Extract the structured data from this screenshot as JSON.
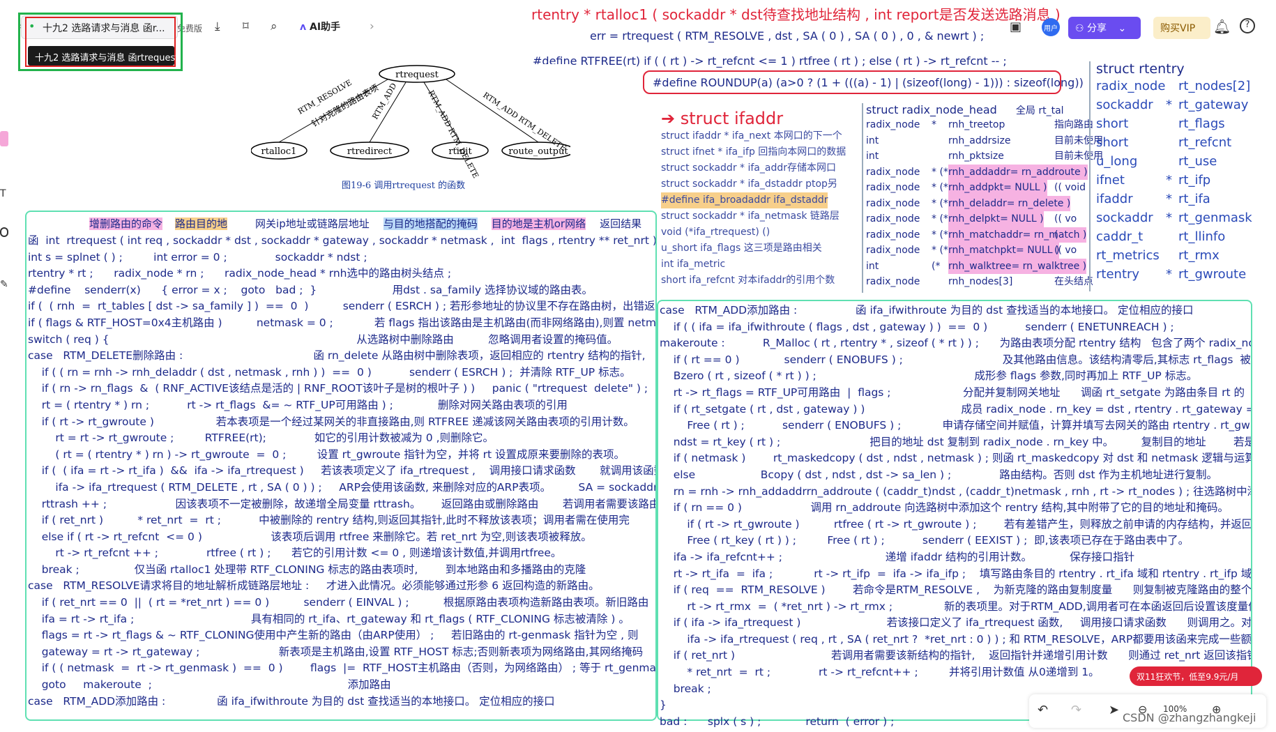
{
  "tab": {
    "title": "十九2 选路请求与消息 函r...",
    "free_label": "免费版",
    "tooltip": "十九2 选路请求与消息 函rtrequest"
  },
  "toolbar": {
    "ai_label": "AI助手",
    "share_label": "分享",
    "vip_label": "购买VIP",
    "user_label": "用户"
  },
  "header_code": {
    "line1": "rtentry * rtalloc1 ( sockaddr * dst待查找地址结构 ,  int  report是否发送选路消息 )",
    "line2": "err = rtrequest ( RTM_RESOLVE , dst , SA ( 0 ) , SA ( 0 ) , 0 , & newrt ) ;",
    "line3": "#define   RTFREE(rt)      if ( ( rt ) -> rt_refcnt <= 1 )    rtfree ( rt ) ;      else     ( rt ) -> rt_refcnt -- ;",
    "line4": "#define   ROUNDUP(a)      (a>0 ? (1 + (((a) - 1) | (sizeof(long) - 1))) : sizeof(long))"
  },
  "figure": {
    "root": "rtrequest",
    "leaves": [
      "rtalloc1",
      "rtredirect",
      "rtinit",
      "route_output"
    ],
    "edges": [
      "RTM_RESOLVE",
      "RTM_ADD",
      "RTM_ADD RTM_DELETE",
      "RTM_ADD RTM_DELETE"
    ],
    "edge_note": "针对克隆的路由表项",
    "caption": "图19-6   调用rtrequest   的函数"
  },
  "ifaddr": {
    "title": "struct ifaddr",
    "fields": [
      "struct ifaddr * ifa_next 本网口的下一个",
      "struct ifnet * ifa_ifp 回指向本网口的数据",
      "struct sockaddr * ifa_addr存储本网口",
      "struct sockaddr * ifa_dstaddr ptop另",
      "#define ifa_broadaddr ifa_dstaddr",
      "struct sockaddr * ifa_netmask 链路层",
      "void (*ifa_rtrequest) ()",
      "u_short ifa_flags      这三项是路由相关",
      "int ifa_metric",
      "short ifa_refcnt 对本ifaddr的引用个数"
    ]
  },
  "radix_head": {
    "title": "struct   radix_node_head",
    "rows": [
      [
        "radix_node",
        "*",
        "rnh_treetop",
        "指向路由"
      ],
      [
        "int",
        "",
        "rnh_addrsize",
        "目前未使用"
      ],
      [
        "int",
        "",
        "rnh_pktsize",
        "目前未使用"
      ],
      [
        "radix_node",
        "* (*",
        "rnh_addaddr= rn_addroute )",
        ""
      ],
      [
        "radix_node",
        "* (*",
        "rnh_addpkt= NULL )",
        "(( void"
      ],
      [
        "radix_node",
        "* (*",
        "rnh_deladdr= rn_delete )",
        ""
      ],
      [
        "radix_node",
        "* (*",
        "rnh_delpkt= NULL )",
        "(( vo"
      ],
      [
        "radix_node",
        "* (*",
        "rnh_matchaddr= rn_match )",
        "("
      ],
      [
        "radix_node",
        "* (*",
        "rnh_matchpkt= NULL )",
        "(( vo"
      ],
      [
        "int",
        "(*",
        "rnh_walktree= rn_walktree )",
        ""
      ],
      [
        "radix_node",
        "",
        "rnh_nodes[3]",
        "在头结点"
      ]
    ],
    "side_note": "全局 rt_tal"
  },
  "rtentry": {
    "title": "struct    rtentry",
    "rows": [
      [
        "radix_node",
        "",
        "rt_nodes[2]"
      ],
      [
        "sockaddr",
        "*",
        "rt_gateway"
      ],
      [
        "short",
        "",
        "rt_flags"
      ],
      [
        "short",
        "",
        "rt_refcnt"
      ],
      [
        "u_long",
        "",
        "rt_use"
      ],
      [
        "ifnet",
        "*",
        "rt_ifp"
      ],
      [
        "ifaddr",
        "*",
        "rt_ifa"
      ],
      [
        "sockaddr",
        "*",
        "rt_genmask"
      ],
      [
        "caddr_t",
        "",
        "rt_llinfo"
      ],
      [
        "rt_metrics",
        "",
        "rt_rmx"
      ],
      [
        "rtentry",
        "*",
        "rt_gwroute"
      ]
    ]
  },
  "left_panel": {
    "header_labels": [
      "增删路由的命令",
      "路由目的地",
      "网关ip地址或链路层地址",
      "与目的地搭配的掩码",
      "目的地是主机or网络",
      "返回结果"
    ],
    "lines": [
      "函  int  rtrequest ( int req , sockaddr * dst , sockaddr * gateway , sockaddr * netmask ,  int  flags , rtentry ** ret_nrt )",
      "int s = splnet ( ) ;         int error = 0 ;              sockaddr * ndst ;",
      "rtentry * rt ;      radix_node * rn ;      radix_node_head * rnh选中的路由树头结点 ;",
      "#define    senderr(x)      { error = x ;    goto   bad ;  }                      用dst . sa_family 选择协议域的路由表。",
      "if (  ( rnh  =  rt_tables [ dst -> sa_family ] )  ==  0  )          senderr ( ESRCH ) ; 若形参地址的协议里不存在路由树，出错返回。",
      "if ( flags & RTF_HOST=0x4主机路由 )          netmask = 0 ;            若 flags 指出该路由是主机路由(而非网络路由),则置 netmask 为空,",
      "switch ( req ) {                                                                        从选路树中删除路由          忽略调用者设置的掩码值。",
      "case   RTM_DELETE删除路由 :                                      函 rn_delete 从路由树中删除表项，返回相应的 rtentry 结构的指针,",
      "    if ( ( rn = rnh -> rnh_deladdr ( dst , netmask , rnh ) )  ==  0 )           senderr ( ESRCH ) ;  并清除 RTF_UP 标志。",
      "    if ( rn -> rn_flags  &  ( RNF_ACTIVE该结点是活的 | RNF_ROOT该叶子是树的根叶子 ) )     panic ( \"rtrequest  delete\" ) ;",
      "    rt = ( rtentry * ) rn ;           rt -> rt_flags  &= ~ RTF_UP可用路由 ) ;             删除对网关路由表项的引用",
      "    if ( rt -> rt_gwroute )                  若本表项是一个经过某网关的非直接路由,则 RTFREE 递减该网关路由表项的引用计数。",
      "        rt = rt -> rt_gwroute ;         RTFREE(rt);              如它的引用计数被减为 0 ,则删除它。",
      "        ( rt = ( rtentry * ) rn ) -> rt_gwroute  =  0 ;         设置 rt_gwroute 指针为空，并将 rt 设置成原来要删除的表项。",
      "    if (  ( ifa = rt -> rt_ifa )  &&  ifa -> ifa_rtrequest )     若该表项定义了 ifa_rtrequest ,    调用接口请求函数       就调用该函数。",
      "        ifa -> ifa_rtrequest ( RTM_DELETE , rt , SA ( 0 ) ) ;     ARP会使用该函数, 来删除对应的ARP表项。        SA = sockaddr *",
      "    rttrash ++ ;                    因该表项不一定被删除，故递增全局变量 rttrash。      返回路由或删除路由       若调用者需要该路由",
      "    if ( ret_nrt )          * ret_nrt  =  rt ;           中被删除的 rentry 结构,则返回其指针,此时不释放该表项；调用者需在使用完",
      "    else if ( rt -> rt_refcnt  <= 0 )                    该表项后调用 rtfree 来删除它。若 ret_nrt 为空,则该表项被释放。",
      "        rt -> rt_refcnt ++ ;              rtfree ( rt ) ;      若它的引用计数 <= 0 , 则递增该计数值,并调用rtfree。",
      "    break ;                仅当函 rtalloc1 处理带 RTF_CLONING 标志的路由表项时,        到本地路由和多播路由的克隆",
      "case   RTM_RESOLVE请求将目的地址解析成链路层地址 :     才进入此情况。必须能够通过形参 6 返回构造的新路由。",
      "    if ( ret_nrt == 0  ||  ( rt = *ret_nrt ) == 0 )          senderr ( EINVAL ) ;          根据原路由表项构造新路由表项。新旧路由",
      "    ifa = rt -> rt_ifa ;                                  具有相同的 rt_ifa、rt_gateway 和 rt_flags ( RTF_CLONING 标志被清除 ) 。",
      "    flags = rt -> rt_flags & ~ RTF_CLONING使用中产生新的路由（由ARP使用） ;     若旧路由的 rt-genmask 指针为空 , 则",
      "    gateway = rt -> rt_gateway ;                       新表项是主机路由,设置 RTF_HOST 标志;否则新表项为网络路由,其网络掩码",
      "    if ( ( netmask  =  rt -> rt_genmask )  ==  0 )        flags  |=  RTF_HOST主机路由（否则，为网络路由） ; 等于 rt_genmask 。",
      "    goto     makeroute  ;                                                         添加路由",
      "case   RTM_ADD添加路由 :               函 ifa_ifwithroute 为目的 dst 查找适当的本地接口。 定位相应的接口"
    ]
  },
  "right_panel": {
    "lines": [
      "case   RTM_ADD添加路由 :                 函 ifa_ifwithroute 为目的 dst 查找适当的本地接口。 定位相应的接口",
      "    if ( ( ifa = ifa_ifwithroute ( flags , dst , gateway ) )  ==  0 )           senderr ( ENETUNREACH ) ;",
      "makeroute :           R_Malloc ( rt , rtentry * , sizeof ( * rt ) ) ;      为路由表项分配 rtentry 结构   包含了两个 radix_node 结构",
      "    if ( rt == 0 )             senderr ( ENOBUFS ) ;                             及其他路由信息。该结构清零后,其标志 rt_flags  被置",
      "    Bzero ( rt , sizeof ( * rt ) ) ;                                              成形参 flags 参数,同时再加上 RTF_UP 标志。",
      "    rt -> rt_flags = RTF_UP可用路由  |  flags ;                     分配并复制网关地址      调函 rt_setgate 为路由条目 rt 的",
      "    if ( rt_setgate ( rt , dst , gateway ) )                            成员 radix_node . rn_key = dst , rtentry . rt_gateway = gateway",
      "        Free ( rt ) ;           senderr ( ENOBUFS ) ;            申请存储空间并赋值，计算并填写去网关的路由 rtentry . rt_gwroute 。",
      "    ndst = rt_key ( rt ) ;                          把目的地址 dst 复制到 radix_node . rn_key 中。        复制目的地址        若是网络地址,",
      "    if ( netmask )        rt_maskedcopy ( dst , ndst , netmask ) ; 则函 rt_maskedcopy 对 dst 和 netmask 逻辑与运算后再填入",
      "    else                   Bcopy ( dst , ndst , dst -> sa_len ) ;              路由结构。否则 dst 作为主机地址进行复制。",
      "    rn = rnh -> rnh_addaddrrn_addroute ( (caddr_t)ndst , (caddr_t)netmask , rnh , rt -> rt_nodes ) ; 往选路树中添加表项",
      "    if ( rn == 0 )                    调用 rn_addroute 向选路树中添加这个 rentry 结构,其中附带了它的目的地址和掩码。",
      "        if ( rt -> rt_gwroute )          rtfree ( rt -> rt_gwroute ) ;        若有差错产生，则释放之前申请的内存结构，并返回EEXIST ,",
      "        Free ( rt_key ( rt ) ) ;         Free ( rt ) ;           senderr ( EEXIST ) ;  即,该表项已存在于路由表中了。",
      "    ifa -> ifa_refcnt++ ;                              递增 ifaddr 结构的引用计数。           保存接口指针",
      "    rt -> rt_ifa  =  ifa ;            rt -> rt_ifp  =  ifa -> ifa_ifp ;    填写路由条目的 rtentry . rt_ifa 域和 rtentry . rt_ifp 域。",
      "    if ( req  ==  RTM_RESOLVE )        若命令是RTM_RESOLVE ,    为新克隆的路由复制度量      则复制被克隆路由的整个度量结构到",
      "        rt -> rt_rmx  =  ( *ret_nrt ) -> rt_rmx ;               新的表项里。对于RTM_ADD,调用者可在本函返回后设置该度量值。",
      "    if ( ifa -> ifa_rtrequest )                         若该接口定义了 ifa_rtrequest 函数,     调用接口请求函数      则调用之。对于RTM_ADD",
      "        ifa -> ifa_rtrequest ( req , rt , SA ( ret_nrt ?  *ret_nrt : 0 ) ) ; 和 RTM_RESOLVE，ARP都要用该函来完成一些额外的处理。",
      "    if ( ret_nrt )                            若调用者需要该新结构的指针,    返回指针并递增引用计数      则通过 ret_nrt 返回该指针,",
      "        * ret_nrt  =  rt ;              rt -> rt_refcnt++ ;         并将引用计数值 从0递增到 1。",
      "    break ;",
      "}",
      "bad :      splx ( s ) ;             return  ( error ) ;"
    ]
  },
  "bottom_bar": {
    "zoom": "100%",
    "watermark": "CSDN @zhangzhangkeji",
    "promo": "双11狂欢节，低至9.9元/月"
  }
}
